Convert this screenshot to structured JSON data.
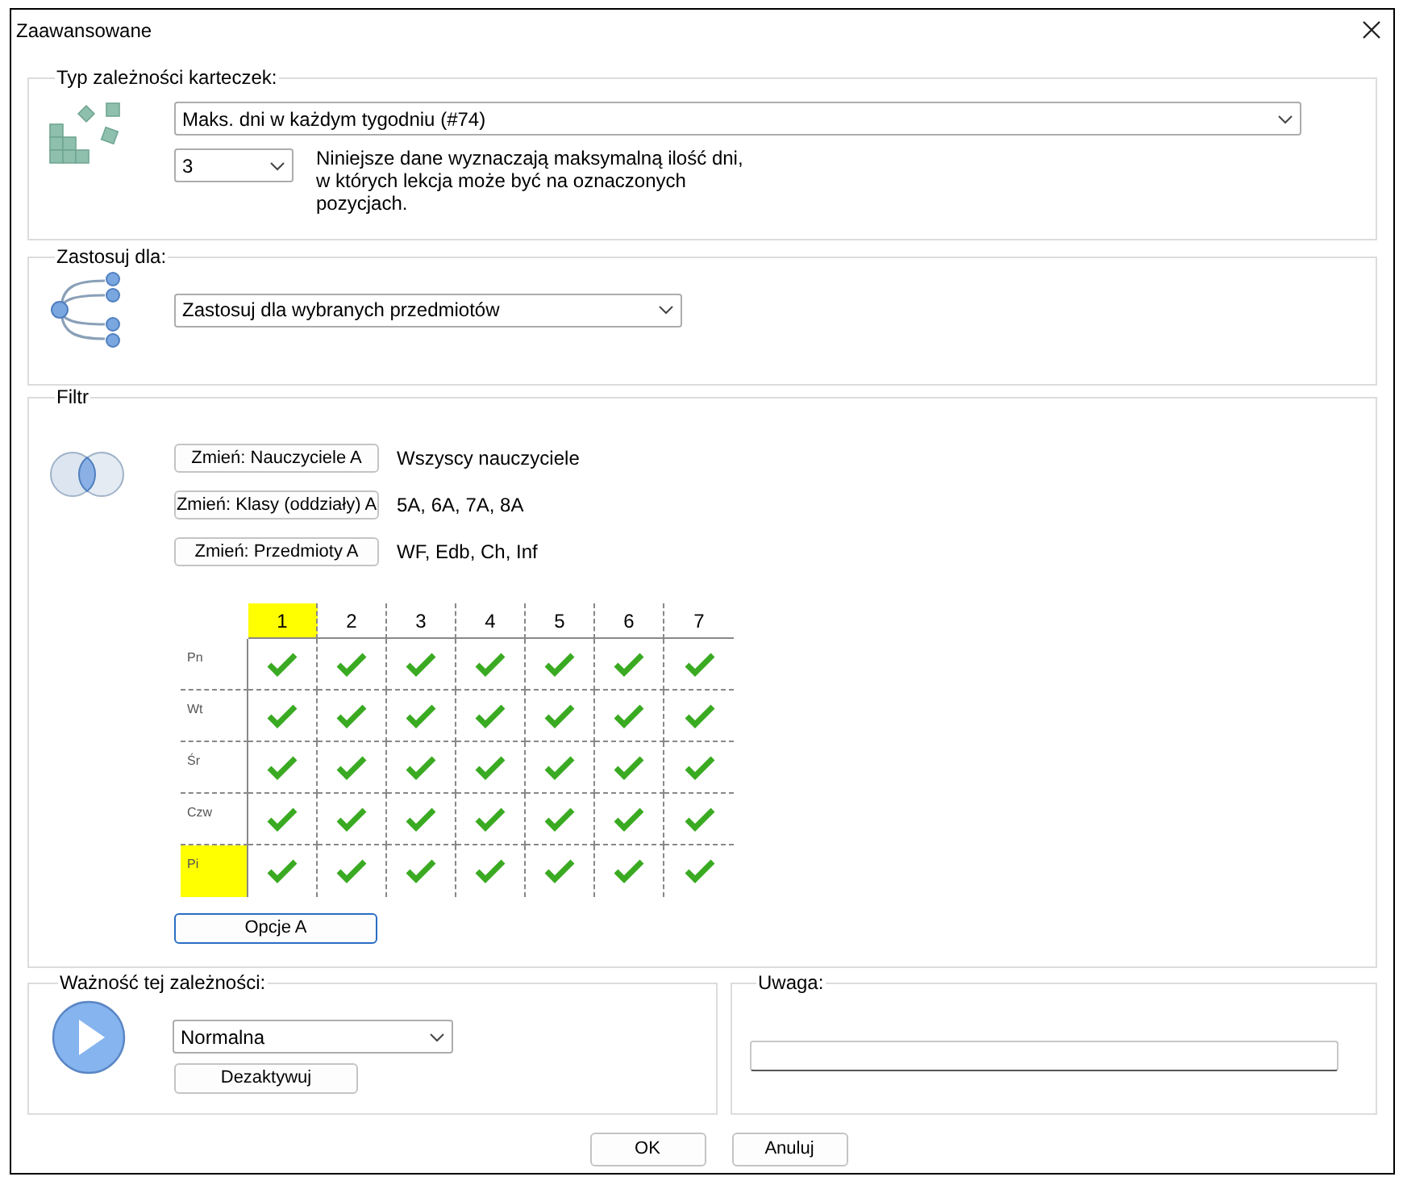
{
  "window": {
    "title": "Zaawansowane"
  },
  "type_group": {
    "legend": "Typ zależności karteczek:",
    "type_select": "Maks. dni w każdym tygodniu (#74)",
    "count_select": "3",
    "description": "Niniejsze dane wyznaczają maksymalną ilość dni, w których lekcja może być na oznaczonych pozycjach."
  },
  "apply_group": {
    "legend": "Zastosuj dla:",
    "select": "Zastosuj dla wybranych przedmiotów"
  },
  "filter": {
    "legend": "Filtr",
    "rows": [
      {
        "button": "Zmień: Nauczyciele A",
        "value": "Wszyscy nauczyciele"
      },
      {
        "button": "Zmień: Klasy (oddziały) A",
        "value": "5A, 6A, 7A, 8A"
      },
      {
        "button": "Zmień: Przedmioty A",
        "value": "WF, Edb, Ch, Inf"
      }
    ],
    "grid": {
      "columns": [
        {
          "label": "1",
          "selected": true
        },
        {
          "label": "2",
          "selected": false
        },
        {
          "label": "3",
          "selected": false
        },
        {
          "label": "4",
          "selected": false
        },
        {
          "label": "5",
          "selected": false
        },
        {
          "label": "6",
          "selected": false
        },
        {
          "label": "7",
          "selected": false
        }
      ],
      "rows": [
        {
          "label": "Pn",
          "selected": false,
          "cells": [
            {
              "checked": true
            },
            {
              "checked": true
            },
            {
              "checked": true
            },
            {
              "checked": true
            },
            {
              "checked": true
            },
            {
              "checked": true
            },
            {
              "checked": true
            }
          ]
        },
        {
          "label": "Wt",
          "selected": false,
          "cells": [
            {
              "checked": true
            },
            {
              "checked": true
            },
            {
              "checked": true
            },
            {
              "checked": true
            },
            {
              "checked": true
            },
            {
              "checked": true
            },
            {
              "checked": true
            }
          ]
        },
        {
          "label": "Śr",
          "selected": false,
          "cells": [
            {
              "checked": true
            },
            {
              "checked": true
            },
            {
              "checked": true
            },
            {
              "checked": true
            },
            {
              "checked": true
            },
            {
              "checked": true
            },
            {
              "checked": true
            }
          ]
        },
        {
          "label": "Czw",
          "selected": false,
          "cells": [
            {
              "checked": true
            },
            {
              "checked": true
            },
            {
              "checked": true
            },
            {
              "checked": true
            },
            {
              "checked": true
            },
            {
              "checked": true
            },
            {
              "checked": true
            }
          ]
        },
        {
          "label": "Pi",
          "selected": true,
          "cells": [
            {
              "checked": true
            },
            {
              "checked": true
            },
            {
              "checked": true
            },
            {
              "checked": true
            },
            {
              "checked": true
            },
            {
              "checked": true
            },
            {
              "checked": true
            }
          ]
        }
      ]
    },
    "options_button": "Opcje A"
  },
  "priority": {
    "legend": "Ważność tej zależności:",
    "select": "Normalna",
    "deactivate_button": "Dezaktywuj"
  },
  "note": {
    "legend": "Uwaga:"
  },
  "buttons": [
    "OK",
    "Anuluj"
  ]
}
